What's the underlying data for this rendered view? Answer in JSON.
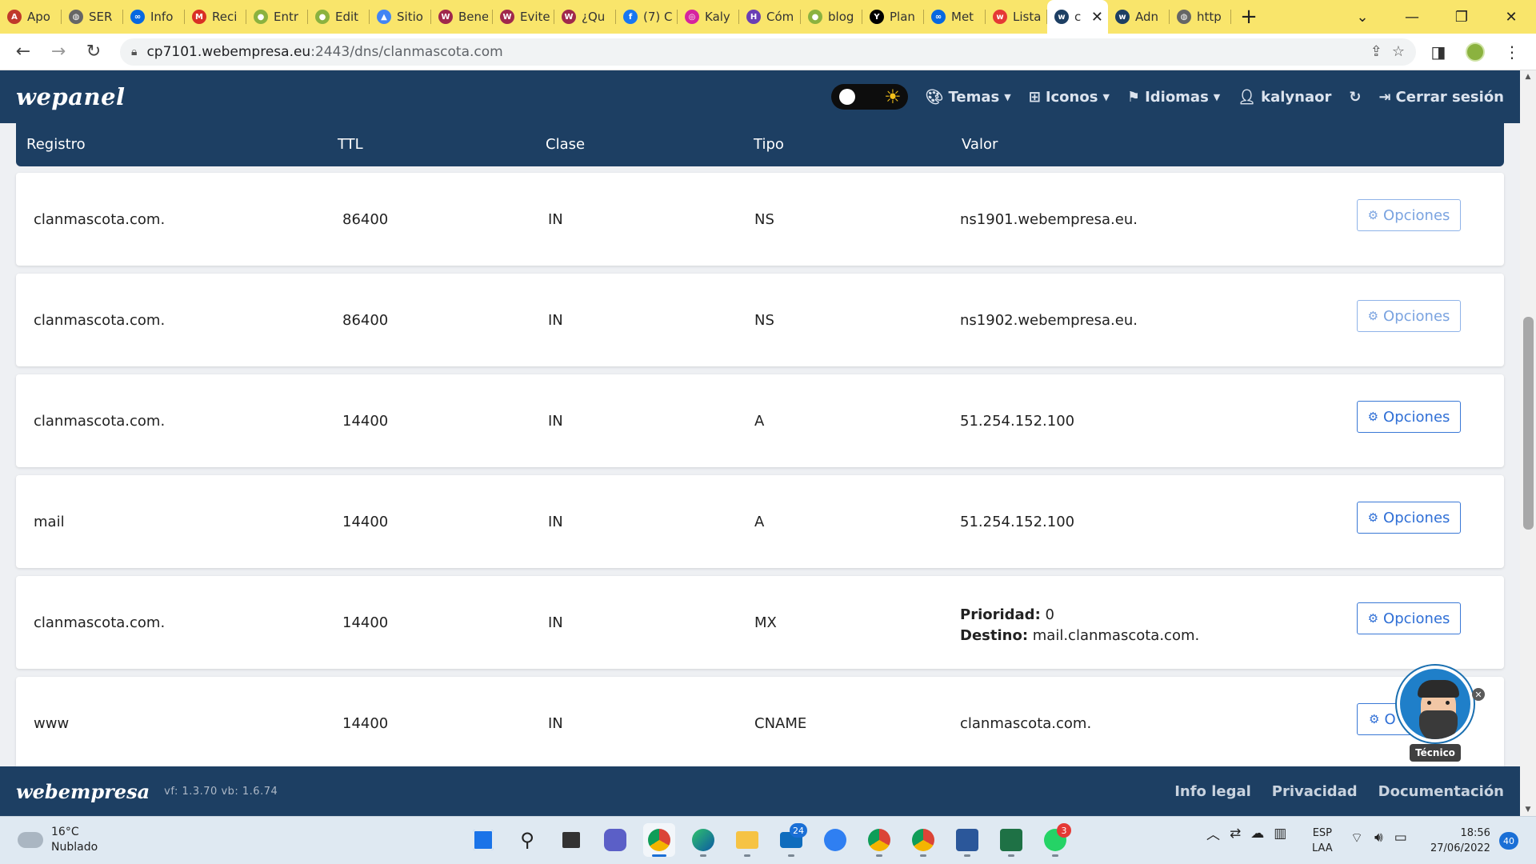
{
  "browser": {
    "tabs": [
      {
        "title": "Apo",
        "fav_color": "#c0392b",
        "fav_glyph": "A"
      },
      {
        "title": "SER",
        "fav_color": "#666666",
        "fav_glyph": "◍"
      },
      {
        "title": "Info",
        "fav_color": "#0668e1",
        "fav_glyph": "∞"
      },
      {
        "title": "Reci",
        "fav_color": "#d93025",
        "fav_glyph": "M"
      },
      {
        "title": "Entr",
        "fav_color": "#8bb23f",
        "fav_glyph": "●"
      },
      {
        "title": "Edit",
        "fav_color": "#8bb23f",
        "fav_glyph": "●"
      },
      {
        "title": "Sitio",
        "fav_color": "#4285f4",
        "fav_glyph": "▲"
      },
      {
        "title": "Bene",
        "fav_color": "#a0284c",
        "fav_glyph": "W"
      },
      {
        "title": "Evite",
        "fav_color": "#a0284c",
        "fav_glyph": "W"
      },
      {
        "title": "¿Qu",
        "fav_color": "#a0284c",
        "fav_glyph": "W"
      },
      {
        "title": "(7) C",
        "fav_color": "#1877f2",
        "fav_glyph": "f"
      },
      {
        "title": "Kaly",
        "fav_color": "#d6249f",
        "fav_glyph": "◎"
      },
      {
        "title": "Cóm",
        "fav_color": "#6a3fb5",
        "fav_glyph": "H"
      },
      {
        "title": "blog",
        "fav_color": "#8bb23f",
        "fav_glyph": "●"
      },
      {
        "title": "Plan",
        "fav_color": "#000000",
        "fav_glyph": "Y"
      },
      {
        "title": "Met",
        "fav_color": "#0668e1",
        "fav_glyph": "∞"
      },
      {
        "title": "Lista",
        "fav_color": "#e53935",
        "fav_glyph": "w"
      },
      {
        "title": "c",
        "fav_color": "#1d3f63",
        "fav_glyph": "w",
        "active": true
      },
      {
        "title": "Adn",
        "fav_color": "#1d3f63",
        "fav_glyph": "w"
      },
      {
        "title": "http",
        "fav_color": "#666666",
        "fav_glyph": "◍"
      }
    ],
    "url_host": "cp7101.webempresa.eu",
    "url_rest": ":2443/dns/clanmascota.com"
  },
  "app": {
    "brand": "wepanel",
    "menu": {
      "temas": "Temas",
      "iconos": "Iconos",
      "idiomas": "Idiomas",
      "user": "kalynaor",
      "logout": "Cerrar sesión"
    }
  },
  "table": {
    "headers": {
      "registro": "Registro",
      "ttl": "TTL",
      "clase": "Clase",
      "tipo": "Tipo",
      "valor": "Valor"
    },
    "options_label": "Opciones",
    "rows": [
      {
        "registro": "clanmascota.com.",
        "ttl": "86400",
        "clase": "IN",
        "tipo": "NS",
        "valor": "ns1901.webempresa.eu."
      },
      {
        "registro": "clanmascota.com.",
        "ttl": "86400",
        "clase": "IN",
        "tipo": "NS",
        "valor": "ns1902.webempresa.eu."
      },
      {
        "registro": "clanmascota.com.",
        "ttl": "14400",
        "clase": "IN",
        "tipo": "A",
        "valor": "51.254.152.100"
      },
      {
        "registro": "mail",
        "ttl": "14400",
        "clase": "IN",
        "tipo": "A",
        "valor": "51.254.152.100"
      },
      {
        "registro": "clanmascota.com.",
        "ttl": "14400",
        "clase": "IN",
        "tipo": "MX",
        "prioridad_label": "Prioridad:",
        "prioridad": "0",
        "destino_label": "Destino:",
        "destino": "mail.clanmascota.com."
      },
      {
        "registro": "www",
        "ttl": "14400",
        "clase": "IN",
        "tipo": "CNAME",
        "valor": "clanmascota.com.",
        "options_partial": "O"
      }
    ]
  },
  "bot": {
    "label": "Técnico"
  },
  "footer": {
    "brand": "webempresa",
    "version": "vf: 1.3.70 vb: 1.6.74",
    "links": [
      "Info legal",
      "Privacidad",
      "Documentación"
    ]
  },
  "taskbar": {
    "temp": "16°C",
    "weather": "Nublado",
    "lang1": "ESP",
    "lang2": "LAA",
    "time": "18:56",
    "date": "27/06/2022",
    "notifications": "40",
    "mail_badge": "24",
    "whatsapp_badge": "3"
  }
}
